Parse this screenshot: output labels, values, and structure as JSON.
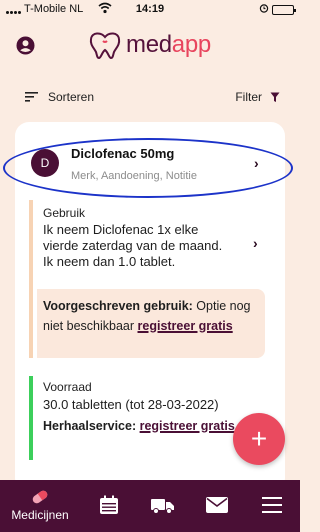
{
  "status_bar": {
    "carrier": "T-Mobile NL",
    "time": "14:19"
  },
  "header": {
    "logo_part1": "med",
    "logo_part2": "app"
  },
  "toolbar": {
    "sort_label": "Sorteren",
    "filter_label": "Filter"
  },
  "medication": {
    "avatar_letter": "D",
    "name": "Diclofenac 50mg",
    "subtitle": "Merk, Aandoening, Notitie",
    "usage_label": "Gebruik",
    "usage_text": "Ik neem Diclofenac 1x elke vierde zaterdag van de maand. Ik neem dan 1.0 tablet.",
    "prescribed_label": "Voorgeschreven gebruik:",
    "prescribed_text": "Optie nog niet beschikbaar",
    "prescribed_link": "registreer gratis",
    "stock_label": "Voorraad",
    "stock_text": "30.0 tabletten (tot 28-03-2022)",
    "refill_label": "Herhaalservice:",
    "refill_link": "registreer gratis"
  },
  "fab_label": "+",
  "bottom_nav": {
    "medicines_label": "Medicijnen"
  },
  "colors": {
    "brand_dark": "#4a0f35",
    "accent": "#ea4a5f",
    "background": "#fbece2",
    "usage_bar": "#f7d3b4",
    "stock_bar": "#3ccf5b"
  }
}
